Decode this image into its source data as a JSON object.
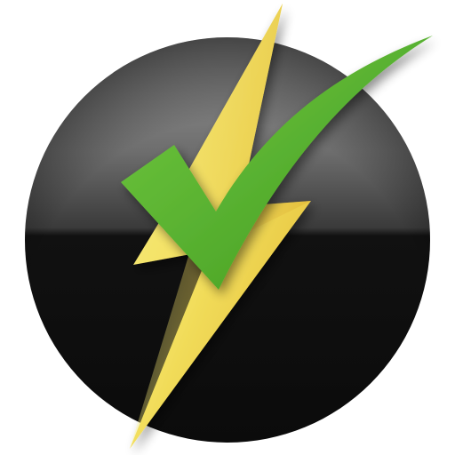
{
  "icon": {
    "name": "lightning-checkmark-icon",
    "colors": {
      "background": "#ffffff",
      "disc_dark": "#0e0e0e",
      "disc_gloss_top": "#8a8a8a",
      "disc_gloss_mid": "#3a3a3a",
      "bolt_light": "#f7ec73",
      "bolt_dark": "#e4b632",
      "check_light": "#6cc33a",
      "check_dark": "#3f9a21"
    }
  }
}
